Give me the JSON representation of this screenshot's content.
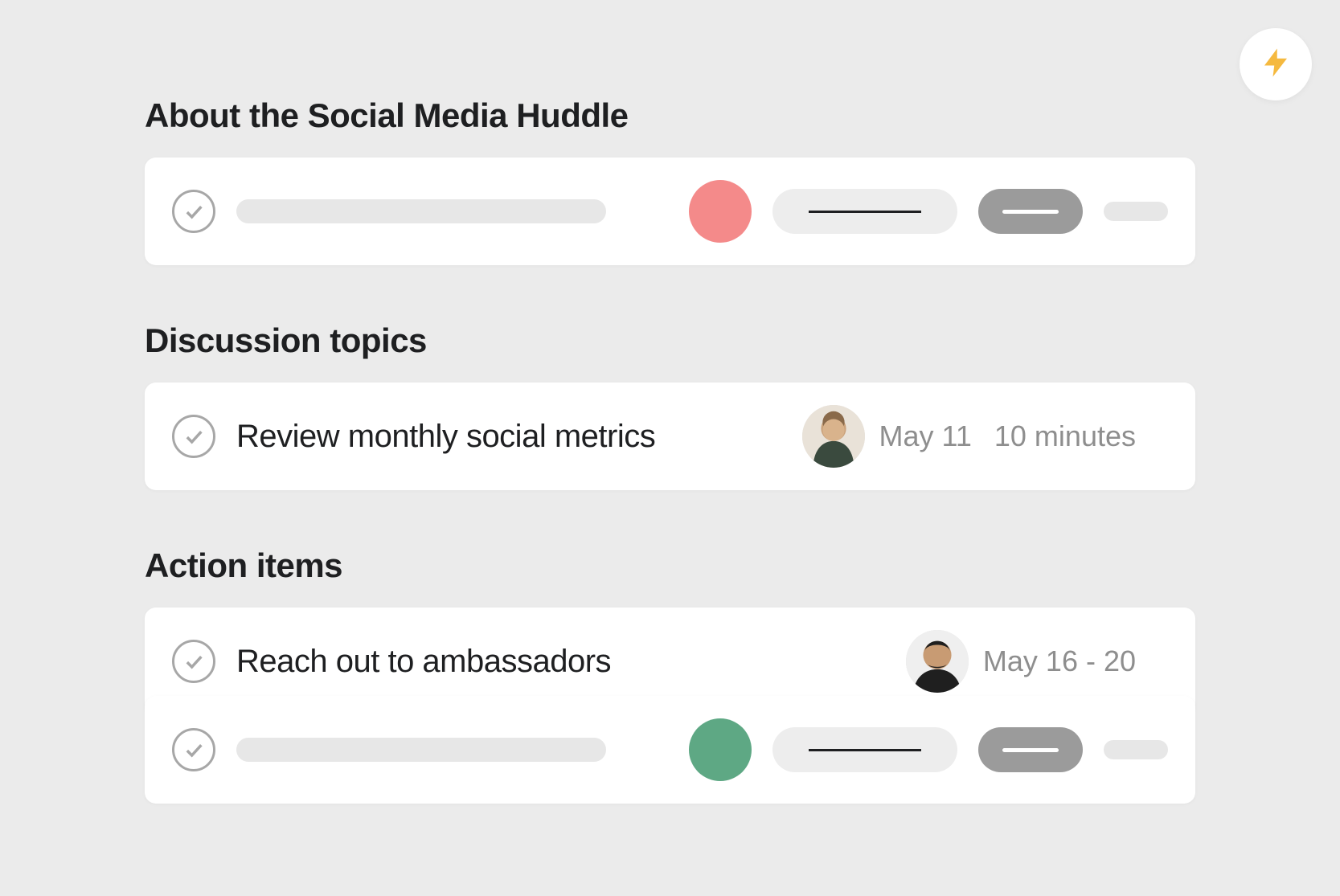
{
  "badge": {
    "icon": "lightning-icon",
    "color": "#f5b93f"
  },
  "sections": {
    "about": {
      "title": "About the Social Media Huddle",
      "placeholder_task": {
        "assignee_color": "#f48a8a"
      }
    },
    "discussion": {
      "title": "Discussion topics",
      "tasks": [
        {
          "title": "Review monthly social metrics",
          "assignee": "avatar-1",
          "date": "May 11",
          "duration": "10 minutes"
        }
      ]
    },
    "action_items": {
      "title": "Action items",
      "tasks": [
        {
          "title": "Reach out to ambassadors",
          "assignee": "avatar-2",
          "date": "May 16 - 20"
        }
      ],
      "placeholder_task": {
        "assignee_color": "#5ea884"
      }
    }
  }
}
